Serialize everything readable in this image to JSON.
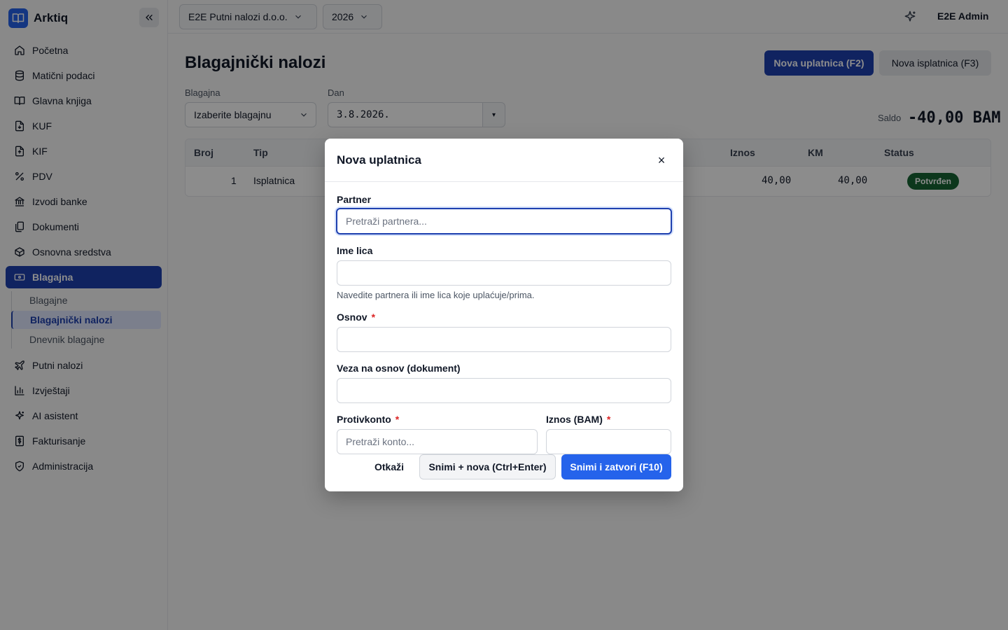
{
  "app": {
    "name": "Arktiq"
  },
  "sidebar": {
    "items": [
      {
        "label": "Početna",
        "icon": "home-icon"
      },
      {
        "label": "Matični podaci",
        "icon": "database-icon"
      },
      {
        "label": "Glavna knjiga",
        "icon": "book-icon"
      },
      {
        "label": "KUF",
        "icon": "file-icon"
      },
      {
        "label": "KIF",
        "icon": "file-icon"
      },
      {
        "label": "PDV",
        "icon": "percent-icon"
      },
      {
        "label": "Izvodi banke",
        "icon": "bank-icon"
      },
      {
        "label": "Dokumenti",
        "icon": "documents-icon"
      },
      {
        "label": "Osnovna sredstva",
        "icon": "box-icon"
      },
      {
        "label": "Blagajna",
        "icon": "cash-icon",
        "active": true
      }
    ],
    "subitems": [
      {
        "label": "Blagajne"
      },
      {
        "label": "Blagajnički nalozi",
        "active": true
      },
      {
        "label": "Dnevnik blagajne"
      }
    ],
    "items_after": [
      {
        "label": "Putni nalozi",
        "icon": "plane-icon"
      },
      {
        "label": "Izvještaji",
        "icon": "chart-icon"
      },
      {
        "label": "AI asistent",
        "icon": "sparkle-icon"
      },
      {
        "label": "Fakturisanje",
        "icon": "invoice-icon"
      },
      {
        "label": "Administracija",
        "icon": "shield-icon"
      }
    ]
  },
  "topbar": {
    "company": "E2E Putni nalozi d.o.o.",
    "year": "2026",
    "user": "E2E Admin"
  },
  "page": {
    "title": "Blagajnički nalozi",
    "btn_new_in": "Nova uplatnica (F2)",
    "btn_new_out": "Nova isplatnica (F3)",
    "register_label": "Blagajna",
    "register_value": "Izaberite blagajnu",
    "day_label": "Dan",
    "day_value": "3.8.2026.",
    "saldo_label": "Saldo",
    "saldo_value": "-40,00 BAM"
  },
  "table": {
    "headers": {
      "broj": "Broj",
      "tip": "Tip",
      "iznos": "Iznos",
      "km": "KM",
      "status": "Status"
    },
    "rows": [
      {
        "broj": "1",
        "tip": "Isplatnica",
        "iznos": "40,00",
        "km": "40,00",
        "status": "Potvrđen"
      }
    ]
  },
  "modal": {
    "title": "Nova uplatnica",
    "partner_label": "Partner",
    "partner_placeholder": "Pretraži partnera...",
    "ime_label": "Ime lica",
    "help": "Navedite partnera ili ime lica koje uplaćuje/prima.",
    "osnov_label": "Osnov",
    "veza_label": "Veza na osnov (dokument)",
    "protivkonto_label": "Protivkonto",
    "protivkonto_placeholder": "Pretraži konto...",
    "iznos_label": "Iznos (BAM)",
    "required_mark": "*",
    "close_symbol": "×",
    "cancel": "Otkaži",
    "save_new": "Snimi + nova (Ctrl+Enter)",
    "save_close": "Snimi i zatvori (F10)"
  },
  "colors": {
    "primary": "#1e40af",
    "primary_button": "#2563eb",
    "success_badge": "#166534",
    "required": "#dc2626"
  }
}
